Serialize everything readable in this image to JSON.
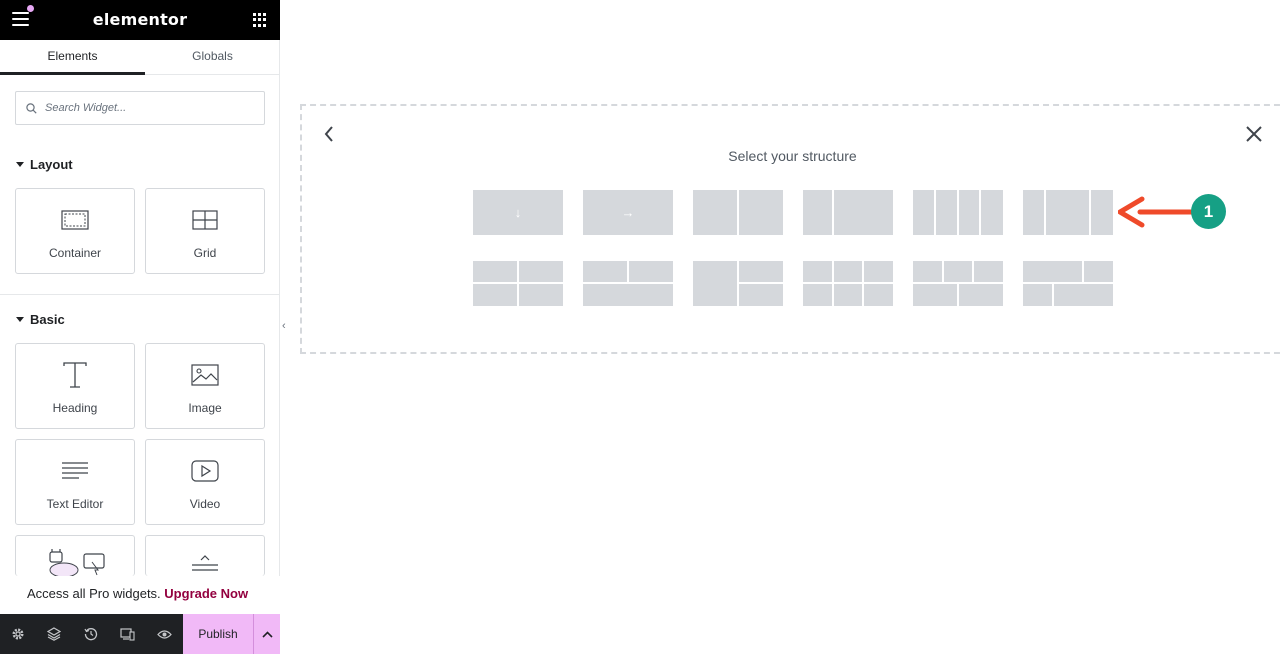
{
  "app": {
    "brand": "elementor",
    "colors": {
      "accent": "#f1b9f7",
      "promo_link": "#93003f",
      "badge": "#16a085",
      "annotation_arrow": "#ef4a2a"
    }
  },
  "tabs": [
    {
      "label": "Elements",
      "active": true
    },
    {
      "label": "Globals",
      "active": false
    }
  ],
  "search": {
    "placeholder": "Search Widget..."
  },
  "sections": {
    "layout": {
      "title": "Layout",
      "widgets": [
        {
          "label": "Container",
          "icon": "container-icon"
        },
        {
          "label": "Grid",
          "icon": "grid-layout-icon"
        }
      ]
    },
    "basic": {
      "title": "Basic",
      "widgets": [
        {
          "label": "Heading",
          "icon": "heading-icon"
        },
        {
          "label": "Image",
          "icon": "image-icon"
        },
        {
          "label": "Text Editor",
          "icon": "text-editor-icon"
        },
        {
          "label": "Video",
          "icon": "video-icon"
        }
      ]
    }
  },
  "promo": {
    "text": "Access all Pro widgets.",
    "link": "Upgrade Now"
  },
  "bottombar": {
    "icons": [
      "settings-icon",
      "layers-icon",
      "history-icon",
      "responsive-icon",
      "preview-icon"
    ],
    "publish_label": "Publish"
  },
  "structure": {
    "title": "Select your structure",
    "presets": [
      "flex-column",
      "flex-row",
      "two-columns",
      "two-columns-wide-right",
      "four-columns",
      "three-columns-wide-middle",
      "grid-2x2",
      "grid-top-split-bottom-full",
      "grid-left-tall-right-stacked",
      "grid-3x2",
      "grid-3-top-2-bottom",
      "grid-2-top-2-bottom-offset"
    ]
  },
  "annotation": {
    "badge": "1"
  }
}
